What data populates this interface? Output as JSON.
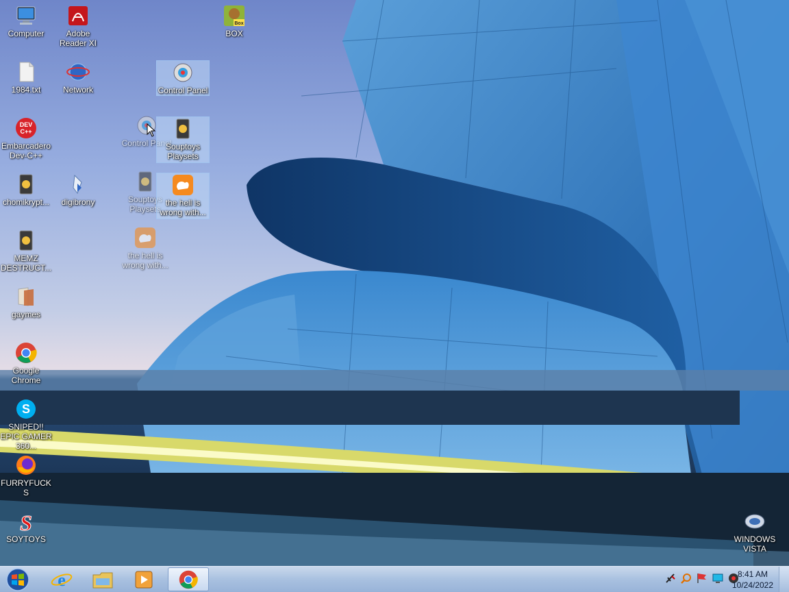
{
  "desktop_icons": [
    {
      "id": "computer",
      "label": "Computer"
    },
    {
      "id": "adobe",
      "label": "Adobe Reader XI"
    },
    {
      "id": "box",
      "label": "BOX"
    },
    {
      "id": "txt",
      "label": "1984.txt"
    },
    {
      "id": "network",
      "label": "Network"
    },
    {
      "id": "controlpanel",
      "label": "Control Panel"
    },
    {
      "id": "devcpp",
      "label": "Embarcadero Dev-C++"
    },
    {
      "id": "controlpanel_drag",
      "label": "Control Panel"
    },
    {
      "id": "souptoys",
      "label": "Souptoys Playsets"
    },
    {
      "id": "chomik",
      "label": "chomikrypt..."
    },
    {
      "id": "digibrony",
      "label": "digibrony"
    },
    {
      "id": "souptoys_drag",
      "label": "Souptoys Playsets"
    },
    {
      "id": "uc",
      "label": "the hell is wrong with..."
    },
    {
      "id": "uc_drag",
      "label": "the hell is wrong with..."
    },
    {
      "id": "memz",
      "label": "MEMZ DESTRUCT..."
    },
    {
      "id": "gaymes",
      "label": "gaymes"
    },
    {
      "id": "chrome",
      "label": "Google Chrome"
    },
    {
      "id": "skype",
      "label": "SNIPED!! EPIC GAMER 360..."
    },
    {
      "id": "firefox",
      "label": "FURRYFUCKS"
    },
    {
      "id": "soytoys",
      "label": "SOYTOYS"
    },
    {
      "id": "vista",
      "label": "WINDOWS VISTA"
    }
  ],
  "taskbar": {
    "pinned": [
      "start-orb",
      "internet-explorer",
      "file-explorer",
      "media-player",
      "google-chrome"
    ],
    "active": "google-chrome"
  },
  "tray": {
    "icons": [
      "action-center-flag",
      "search-magnifier",
      "flag",
      "display",
      "speaker"
    ]
  },
  "clock": {
    "time": "8:41 AM",
    "date": "10/24/2022"
  },
  "colors": {
    "taskbar": "#a9c1e0",
    "selection": "#bed7f5",
    "text": "#ffffff"
  }
}
